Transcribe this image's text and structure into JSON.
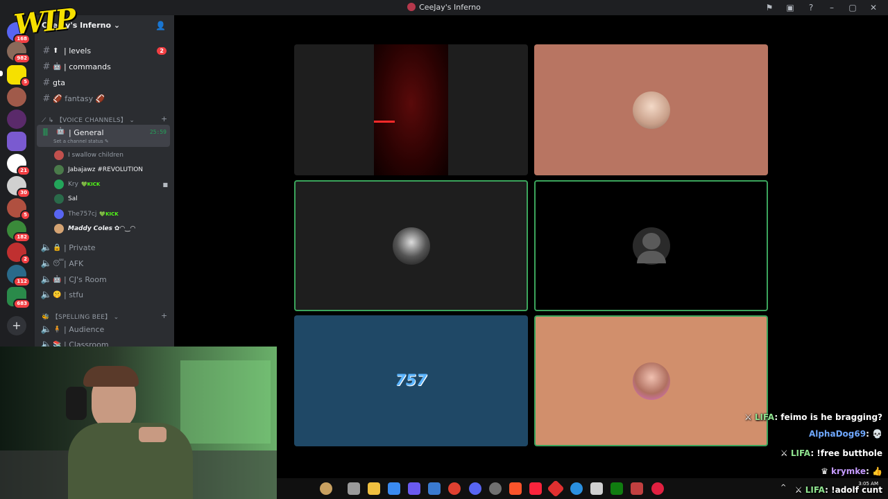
{
  "window": {
    "title": "CeeJay's Inferno"
  },
  "overlay": {
    "wip_text": "WIP",
    "clock": "3:05 AM"
  },
  "rail": {
    "badges": [
      "168",
      "982",
      "5",
      "21",
      "30",
      "5",
      "182",
      "2",
      "112",
      "683"
    ]
  },
  "sidebar": {
    "server_name": "CeeJay's Inferno",
    "text_channels": [
      {
        "label": "| levels",
        "emoji": "⬆",
        "unread": "2"
      },
      {
        "label": "| commands",
        "emoji": "🤖",
        "unread": ""
      },
      {
        "label": "gta",
        "emoji": "",
        "unread": ""
      },
      {
        "label": "🏈 fantasy 🏈",
        "emoji": "",
        "unread": ""
      }
    ],
    "voice_category": "【VOICE CHANNELS】",
    "active_voice": {
      "name": "| General",
      "timer": "25:59",
      "status_prompt": "Set a channel status"
    },
    "members": [
      {
        "name": "I swallow children",
        "tag": "",
        "color": "#c0504d"
      },
      {
        "name": "Jabajawz #REVOLUTION",
        "tag": "",
        "color": "#4a7a4a"
      },
      {
        "name": "Kry",
        "tag": "KICK",
        "color": "#23a55a"
      },
      {
        "name": "Sal",
        "tag": "",
        "color": "#2a6a4a"
      },
      {
        "name": "The757cj",
        "tag": "KICK",
        "color": "#5865f2"
      },
      {
        "name": "𝙈𝙖𝙙𝙙𝙮 𝘾𝙤𝙡𝙚𝙨 ✿◠‿◠",
        "tag": "",
        "color": "#d4a373"
      }
    ],
    "voice_channels": [
      {
        "label": "| Private",
        "emoji": "🔒"
      },
      {
        "label": "| AFK",
        "emoji": "😴"
      },
      {
        "label": "| CJ's Room",
        "emoji": "🤖"
      },
      {
        "label": "| stfu",
        "emoji": "🤫"
      }
    ],
    "spelling_category": "【SPELLING BEE】",
    "spelling_channels": [
      {
        "label": "| Audience",
        "emoji": "🧍"
      },
      {
        "label": "| Classroom",
        "emoji": "📚"
      }
    ]
  },
  "chat": [
    {
      "user": "LIFA",
      "text": ": feimo is he bragging?",
      "cls": "u1"
    },
    {
      "user": "AlphaDog69",
      "text": ":",
      "cls": "u2"
    },
    {
      "user": "LIFA",
      "text": ": !free butthole",
      "cls": "u1"
    },
    {
      "user": "krymke",
      "text": ":",
      "cls": "u3"
    },
    {
      "user": "LIFA",
      "text": ": !adolf cunt",
      "cls": "u1"
    }
  ],
  "colors": {
    "tile_dark": "#1e1e1e",
    "tile_salmon": "#b87562",
    "tile_blue": "#1f4866",
    "tile_peach": "#d18f6c",
    "speaking": "#3ba55c"
  }
}
